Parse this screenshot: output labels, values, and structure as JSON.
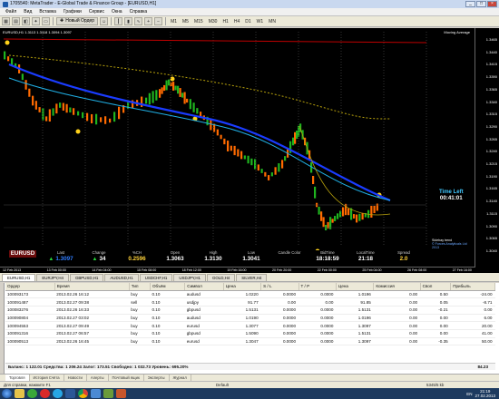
{
  "window": {
    "title": "1705540: MetaTrader - E-Global Trade & Finance Group - [EURUSD,H1]"
  },
  "menu": [
    "Файл",
    "Вид",
    "Вставка",
    "Графики",
    "Сервис",
    "Окна",
    "Справка"
  ],
  "toolbar": {
    "new_order": "Новый Ордер",
    "timeframes": [
      "M1",
      "M5",
      "M15",
      "M30",
      "H1",
      "H4",
      "D1",
      "W1",
      "MN"
    ]
  },
  "chart": {
    "title": "EURUSD,H1  1.3113 1.3118 1.3094 1.3097",
    "indicator_label": "Moving Average",
    "price_ticks": [
      "1.3465",
      "1.3440",
      "1.3415",
      "1.3390",
      "1.3365",
      "1.3340",
      "1.3315",
      "1.3290",
      "1.3265",
      "1.3240",
      "1.3215",
      "1.3190",
      "1.3165",
      "1.3140",
      "1.3115",
      "1.3090",
      "1.3065",
      "1.3040"
    ],
    "time_ticks": [
      "12 Feb 2013",
      "13 Feb 00:00",
      "14 Feb 04:00",
      "15 Feb 08:00",
      "18 Feb 12:00",
      "19 Feb 16:00",
      "20 Feb 20:00",
      "22 Feb 00:00",
      "25 Feb 04:00",
      "26 Feb 08:00",
      "27 Feb 16:00"
    ],
    "zone_labels": [
      "Zone 0.1 - 1.3218",
      "Zone 0.5 - 1.3136",
      "Zone 0.9 - 1.3057"
    ],
    "colors": {
      "bull": "#1fb51f",
      "bear": "#ff6a00",
      "ma_blue": "#1a3cff",
      "ma_cyan": "#20b0e6",
      "ma_gold": "#b8a20c",
      "line_red": "#c00000"
    }
  },
  "info_bar": [
    {
      "head": "",
      "value": "EURUSD",
      "style": "red-box"
    },
    {
      "head": "Last",
      "value": "1.3097",
      "style": "blue",
      "arrow": true
    },
    {
      "head": "Change",
      "value": "34",
      "style": "",
      "arrow": true
    },
    {
      "head": "%CH",
      "value": "0.2596",
      "style": "gold"
    },
    {
      "head": "Open",
      "value": "1.3063",
      "style": ""
    },
    {
      "head": "High",
      "value": "1.3130",
      "style": ""
    },
    {
      "head": "Low",
      "value": "1.3041",
      "style": ""
    },
    {
      "head": "Candle Color",
      "value": "",
      "style": ""
    },
    {
      "head": "BidTime",
      "value": "18:18:59",
      "style": ""
    },
    {
      "head": "LocalTime",
      "value": "21:18",
      "style": ""
    },
    {
      "head": "Spread",
      "value": "2.0",
      "style": "gold"
    }
  ],
  "time_left": {
    "label": "Time Left",
    "value": "00:41:01"
  },
  "sidebar_notes": [
    "Sidebay trend",
    "© Forces Analyticals Ltd 2013"
  ],
  "chart_tabs": [
    {
      "label": "EURUSD,H1",
      "active": true
    },
    {
      "label": "EURJPY,H4",
      "active": false
    },
    {
      "label": "GBPUSD,H1",
      "active": false
    },
    {
      "label": "AUDUSD,H1",
      "active": false
    },
    {
      "label": "USDCHF,H1",
      "active": false
    },
    {
      "label": "USDJPY,H1",
      "active": false
    },
    {
      "label": "GOLD,H4",
      "active": false
    },
    {
      "label": "SILVER,H4",
      "active": false
    }
  ],
  "orders": {
    "columns": [
      "Ордер",
      "Время",
      "Тип",
      "Объём",
      "Символ",
      "Цена",
      "S / L",
      "T / P",
      "Цена",
      "Комиссия",
      "Своп",
      "Прибыль"
    ],
    "rows": [
      [
        "100093173",
        "2013.02.26 16:12",
        "buy",
        "0.10",
        "audusd",
        "1.0220",
        "0.0000",
        "0.0000",
        "1.0196",
        "0.00",
        "0.50",
        "-24.00"
      ],
      [
        "100091487",
        "2013.02.27 09:38",
        "sell",
        "0.10",
        "usdjpy",
        "91.77",
        "0.00",
        "0.00",
        "91.85",
        "0.00",
        "0.05",
        "-8.71"
      ],
      [
        "100083276",
        "2013.02.26 16:33",
        "buy",
        "0.10",
        "gbpusd",
        "1.5131",
        "0.0000",
        "0.0000",
        "1.5131",
        "0.00",
        "-0.21",
        "0.00"
      ],
      [
        "100090804",
        "2013.02.27 03:02",
        "buy",
        "0.10",
        "audusd",
        "1.0190",
        "0.0000",
        "0.0000",
        "1.0196",
        "0.00",
        "0.00",
        "6.00"
      ],
      [
        "100094553",
        "2013.02.27 09:49",
        "buy",
        "0.10",
        "eurusd",
        "1.3077",
        "0.0000",
        "0.0000",
        "1.3097",
        "0.00",
        "0.00",
        "20.00"
      ],
      [
        "100091316",
        "2013.02.27 06:57",
        "buy",
        "0.10",
        "gbpusd",
        "1.5090",
        "0.0000",
        "0.0000",
        "1.5131",
        "0.00",
        "0.00",
        "41.00"
      ],
      [
        "100090513",
        "2013.02.26 16:45",
        "buy",
        "0.10",
        "eurusd",
        "1.3047",
        "0.0000",
        "0.0000",
        "1.3097",
        "0.00",
        "-0.35",
        "50.00"
      ]
    ],
    "balance": "Баланс: 1 122.01  Средства: 1 206.24  Залог: 173.51  Свободно: 1 032.73  Уровень: 695.20%",
    "total": "84.23"
  },
  "terminal_tabs": [
    "Торговля",
    "История Счёта",
    "Новости",
    "Алерты",
    "Почтовый ящик",
    "Эксперты",
    "Журнал"
  ],
  "status": {
    "help": "Для справки, нажмите F1",
    "profile": "Default",
    "traffic": "5345/5 kb"
  },
  "taskbar": {
    "lang": "EN",
    "time": "21:19",
    "date": "27.02.2013"
  }
}
